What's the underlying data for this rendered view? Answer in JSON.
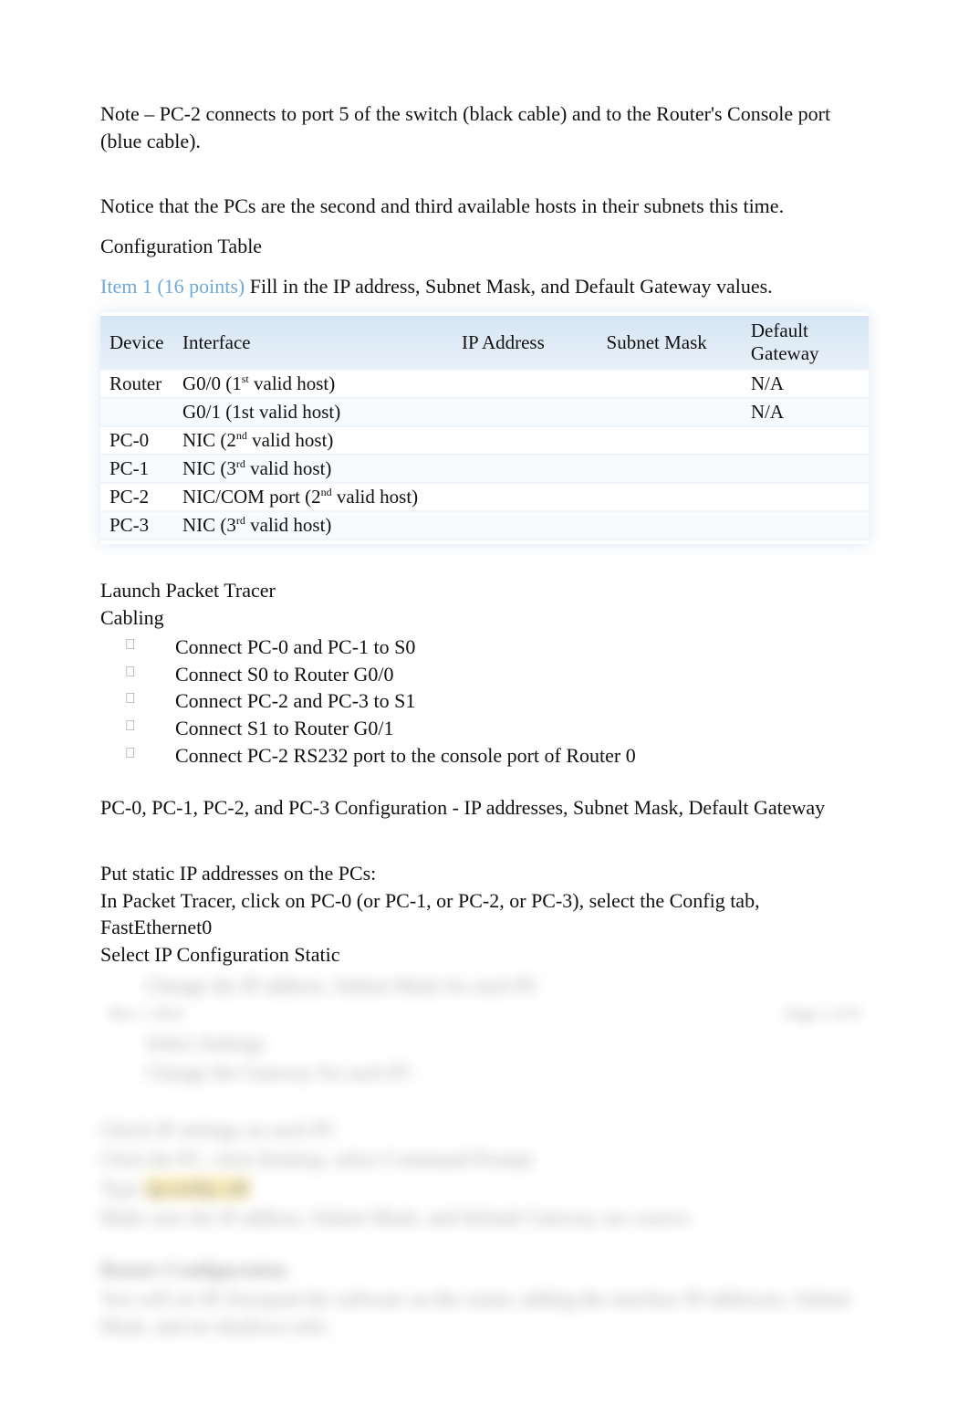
{
  "intro": {
    "note_line": "Note – PC-2 connects to port 5 of the switch (black cable) and to the Router's Console port (blue cable).",
    "notice_line": "Notice that the PCs are the second and third available hosts in their subnets this time.",
    "config_table_label": "Configuration Table",
    "item1_label": "Item 1 (16 points)",
    "item1_rest": "  Fill in the IP address, Subnet Mask, and Default Gateway values."
  },
  "table": {
    "headers": {
      "device": "Device",
      "interface": "Interface",
      "ip": "IP Address",
      "subnet": "Subnet Mask",
      "gateway": "Default Gateway"
    },
    "rows": [
      {
        "device": "Router",
        "iface_pre": "G0/0 (1",
        "iface_sup": "st",
        "iface_post": "  valid host)",
        "ip": "",
        "subnet": "",
        "gateway": "N/A"
      },
      {
        "device": "",
        "iface_pre": "G0/1 (1st valid host)",
        "iface_sup": "",
        "iface_post": "",
        "ip": "",
        "subnet": "",
        "gateway": "N/A"
      },
      {
        "device": "PC-0",
        "iface_pre": "NIC (2",
        "iface_sup": "nd",
        "iface_post": " valid host)",
        "ip": "",
        "subnet": "",
        "gateway": ""
      },
      {
        "device": "PC-1",
        "iface_pre": "NIC (3",
        "iface_sup": "rd",
        "iface_post": "  valid host)",
        "ip": "",
        "subnet": "",
        "gateway": ""
      },
      {
        "device": "PC-2",
        "iface_pre": "NIC/COM port (2",
        "iface_sup": "nd",
        "iface_post": " valid host)",
        "ip": "",
        "subnet": "",
        "gateway": ""
      },
      {
        "device": "PC-3",
        "iface_pre": "NIC (3",
        "iface_sup": "rd",
        "iface_post": " valid host)",
        "ip": "",
        "subnet": "",
        "gateway": ""
      }
    ]
  },
  "section": {
    "launch": "Launch Packet Tracer",
    "cabling": "Cabling",
    "bullets": [
      "Connect PC-0 and PC-1 to S0",
      "Connect S0 to Router G0/0",
      "Connect PC-2 and PC-3 to S1",
      "Connect S1 to Router G0/1",
      "Connect PC-2 RS232 port to the console port of Router 0"
    ],
    "marker": "⎕",
    "pc_config_title": "PC-0, PC-1, PC-2, and PC-3 Configuration - IP addresses, Subnet Mask, Default Gateway",
    "static_ip": "Put static IP addresses on the PCs:",
    "packet_tracer": "In Packet Tracer, click on PC-0 (or PC-1, or PC-2, or PC-3), select the Config tab, FastEthernet0",
    "select_static": "Select IP Configuration Static"
  },
  "blurred": {
    "indent_lines": [
      "Change the IP address, Subnet Mask for each PC",
      "",
      "Select Settings",
      "Change the Gateway for each PC"
    ],
    "block2_lines": [
      "Check IP settings on each PC",
      "Click the PC, click Desktop, select Command Prompt"
    ],
    "block2_type_prefix": "Type ",
    "block2_type_cmd": "ipconfig /all",
    "block2_make": "Make sure the IP address, Subnet Mask, and Default Gateway are correct.",
    "block3_title": "Router Configuration",
    "block3_body": "You will set IP, Encapsul the software on the router, adding the interface IP addresses, Subnet Mask, and no-shudown info."
  },
  "footer": {
    "left": "Rev 1 2021",
    "right": "Page 2 of 8"
  }
}
